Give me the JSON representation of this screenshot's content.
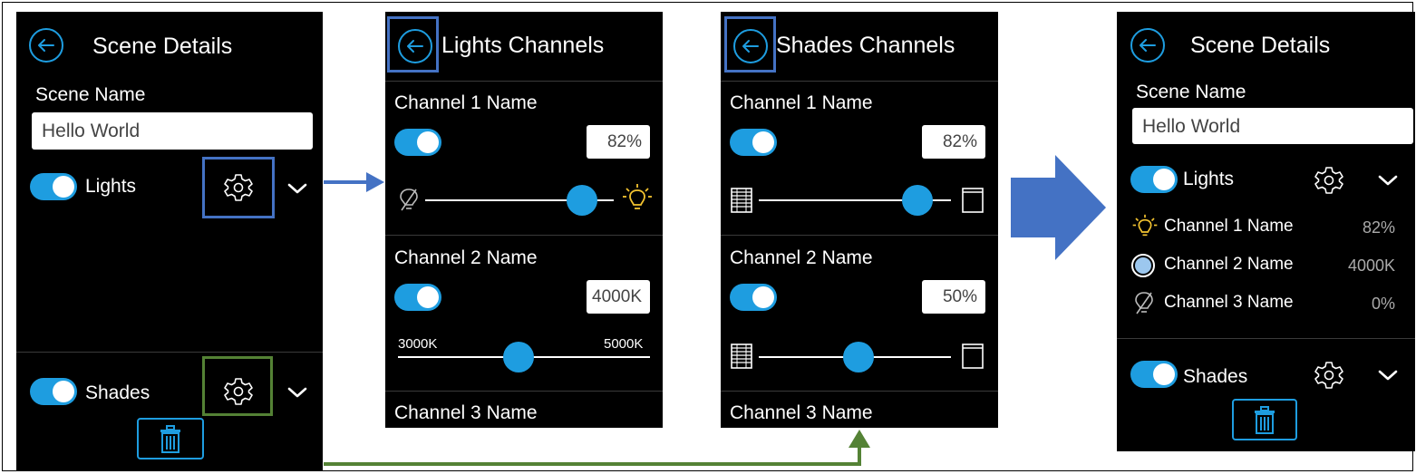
{
  "colors": {
    "accent": "#1e9de0",
    "highlight_blue": "#4472c4",
    "highlight_green": "#548235",
    "bulb_yellow": "#f4c430",
    "panel_bg": "#000000"
  },
  "panel1": {
    "title": "Scene Details",
    "scene_name_label": "Scene Name",
    "scene_name_value": "Hello World",
    "lights_label": "Lights",
    "shades_label": "Shades"
  },
  "panel2": {
    "title": "Lights Channels",
    "channels": [
      {
        "name": "Channel 1 Name",
        "value": "82%",
        "level": 0.82
      },
      {
        "name": "Channel 2 Name",
        "value": "4000K",
        "min_label": "3000K",
        "max_label": "5000K",
        "level": 0.5
      },
      {
        "name": "Channel 3 Name"
      }
    ]
  },
  "panel3": {
    "title": "Shades Channels",
    "channels": [
      {
        "name": "Channel 1 Name",
        "value": "82%",
        "level": 0.82
      },
      {
        "name": "Channel 2 Name",
        "value": "50%",
        "level": 0.5
      },
      {
        "name": "Channel 3 Name"
      }
    ]
  },
  "panel4": {
    "title": "Scene Details",
    "scene_name_label": "Scene Name",
    "scene_name_value": "Hello World",
    "lights_label": "Lights",
    "shades_label": "Shades",
    "channels": [
      {
        "name": "Channel 1 Name",
        "value": "82%",
        "icon": "bulb-on-icon"
      },
      {
        "name": "Channel 2 Name",
        "value": "4000K",
        "icon": "color-temp-icon"
      },
      {
        "name": "Channel 3 Name",
        "value": "0%",
        "icon": "bulb-off-icon"
      }
    ]
  }
}
